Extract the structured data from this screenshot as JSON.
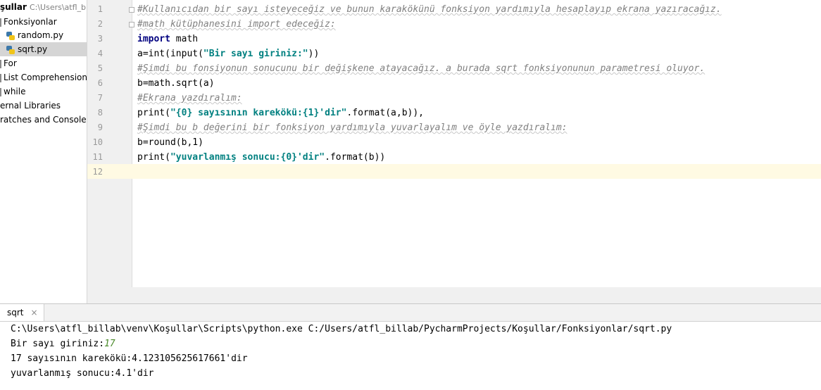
{
  "project_tree": {
    "root_label": "şullar",
    "root_path": "C:\\Users\\atfl_billa",
    "items": [
      {
        "label": "Fonksiyonlar",
        "type": "folder"
      },
      {
        "label": "random.py",
        "type": "python-file"
      },
      {
        "label": "sqrt.py",
        "type": "python-file",
        "selected": true
      },
      {
        "label": "For",
        "type": "folder"
      },
      {
        "label": "List Comprehension",
        "type": "folder"
      },
      {
        "label": "while",
        "type": "folder"
      },
      {
        "label": "ernal Libraries",
        "type": "library"
      },
      {
        "label": "ratches and Consoles",
        "type": "scratches"
      }
    ]
  },
  "editor": {
    "line_numbers": [
      "1",
      "2",
      "3",
      "4",
      "5",
      "6",
      "7",
      "8",
      "9",
      "10",
      "11",
      "12"
    ],
    "lines": {
      "l1": "#Kullanıcıdan bir sayı isteyeceğiz ve bunun karakökünü fonksiyon yardımıyla hesaplayıp ekrana yazıracağız.",
      "l2": "#math kütüphanesini import edeceğiz:",
      "l3_kw": "import",
      "l3_rest": " math",
      "l4_a": "a=int(input(",
      "l4_str": "\"Bir sayı giriniz:\"",
      "l4_b": "))",
      "l5": "#Şimdi bu fonsiyonun sonucunu bir değişkene atayacağız. a burada sqrt fonksiyonunun parametresi oluyor.",
      "l6": "b=math.sqrt(a)",
      "l7": "#Ekrana yazdıralım:",
      "l8_a": "print(",
      "l8_str": "\"{0} sayısının karekökü:{1}'dir\"",
      "l8_b": ".format(a,b)),",
      "l9": "#Şimdi bu b değerini bir fonksiyon yardımıyla yuvarlayalım ve öyle yazdıralım:",
      "l10": "b=round(b,1)",
      "l11_a": "print(",
      "l11_str": "\"yuvarlanmış sonucu:{0}'dir\"",
      "l11_b": ".format(b))",
      "l12": ""
    }
  },
  "run_panel": {
    "tab_label": "sqrt",
    "close_glyph": "×",
    "command": "C:\\Users\\atfl_billab\\venv\\Koşullar\\Scripts\\python.exe C:/Users/atfl_billab/PycharmProjects/Koşullar/Fonksiyonlar/sqrt.py",
    "prompt": "Bir sayı giriniz:",
    "user_input": "17",
    "output_1": "17 sayısının karekökü:4.123105625617661'dir",
    "output_2": "yuvarlanmış sonucu:4.1'dir"
  },
  "colors": {
    "comment": "#808080",
    "keyword": "#000080",
    "string": "#008080",
    "user_input": "#4a8a2a",
    "caret_line": "#fffae3",
    "selected_row": "#d5d5d5"
  }
}
